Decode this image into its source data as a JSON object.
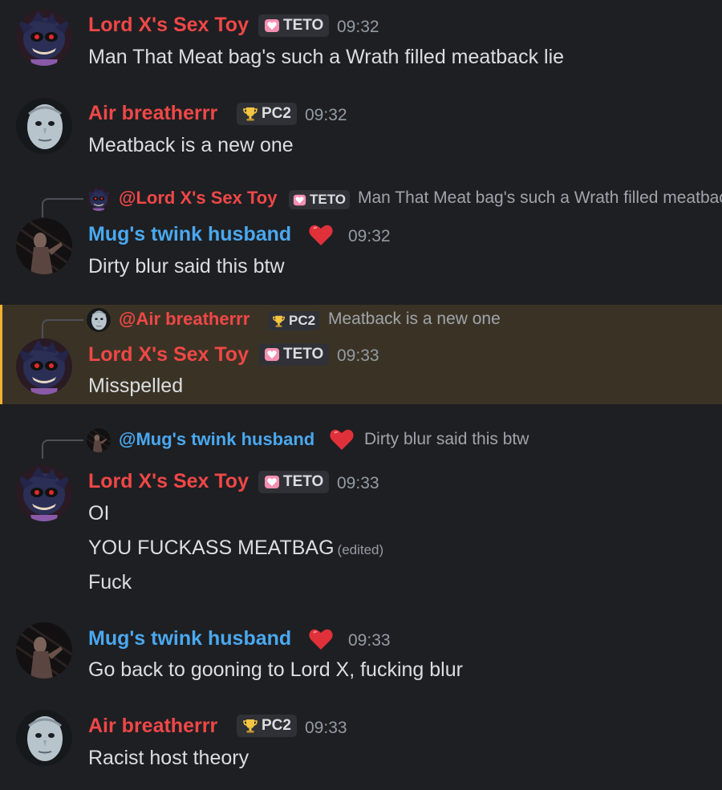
{
  "colors": {
    "background": "#1e1f22",
    "name_red": "#f04747",
    "name_blue": "#4aa8f0",
    "highlight_bar": "#f0b232",
    "highlight_bg": "#3a3325"
  },
  "badges": {
    "teto": {
      "label": "TETO",
      "icon": "pink-heart-icon"
    },
    "pc2": {
      "label": "PC2",
      "icon": "trophy-icon"
    }
  },
  "messages": [
    {
      "author": "Lord X's Sex Toy",
      "time": "09:32",
      "lines": [
        "Man That Meat bag's such a Wrath filled meatback lie"
      ]
    },
    {
      "author": "Air breatherrr",
      "time": "09:32",
      "lines": [
        "Meatback is a new one"
      ]
    },
    {
      "reply_to": "@Lord X's Sex Toy",
      "reply_text": "Man That Meat bag's such a Wrath filled meatback lie",
      "author": "Mug's twink husband",
      "time": "09:32",
      "lines": [
        "Dirty blur said this btw"
      ]
    },
    {
      "reply_to": "@Air breatherrr",
      "reply_text": "Meatback is a new one",
      "author": "Lord X's Sex Toy",
      "time": "09:33",
      "lines": [
        "Misspelled"
      ]
    },
    {
      "reply_to": "@Mug's twink husband",
      "reply_text": "Dirty blur said this btw",
      "author": "Lord X's Sex Toy",
      "time": "09:33",
      "lines": [
        "OI",
        "YOU FUCKASS MEATBAG",
        "Fuck"
      ],
      "edited_label": "(edited)"
    },
    {
      "author": "Mug's twink husband",
      "time": "09:33",
      "lines": [
        "Go back to gooning to Lord X, fucking blur"
      ]
    },
    {
      "author": "Air breatherrr",
      "time": "09:33",
      "lines": [
        "Racist host theory"
      ]
    }
  ]
}
